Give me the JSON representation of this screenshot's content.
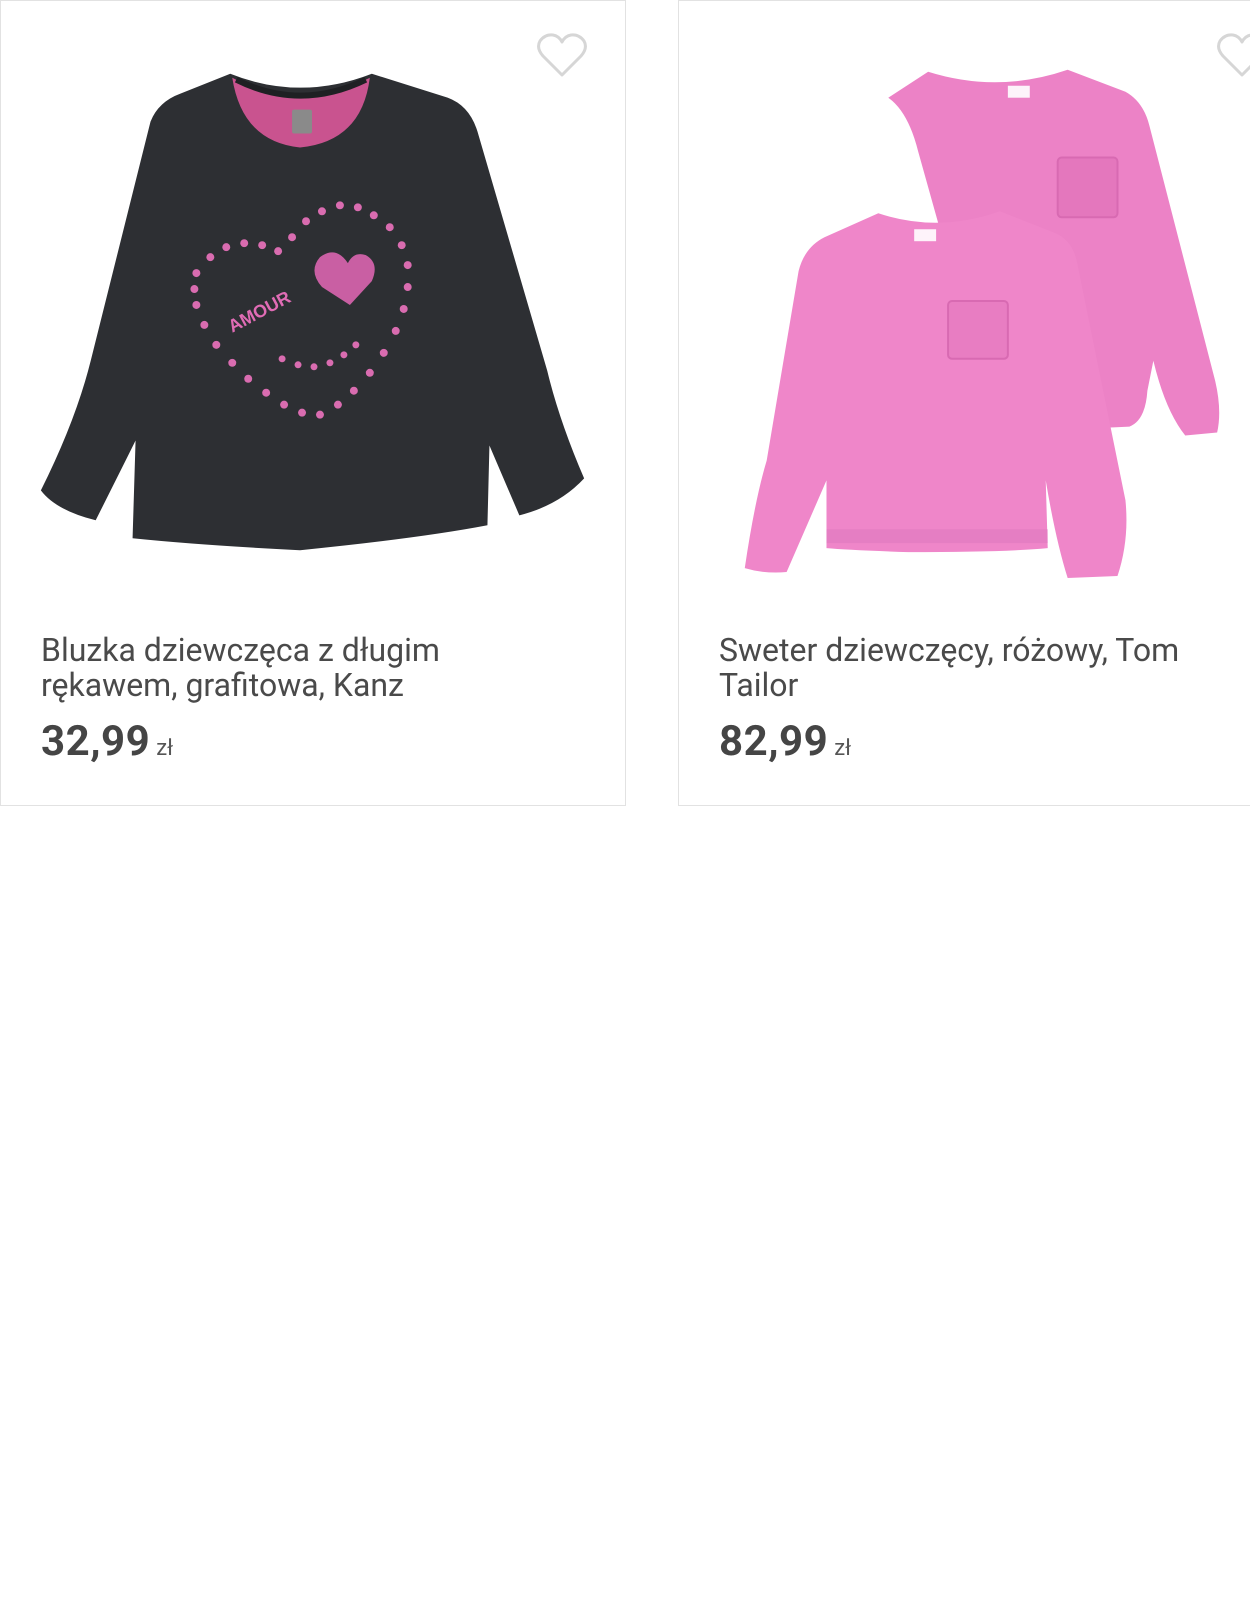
{
  "products": [
    {
      "title": "Bluzka dziewczęca z długim rękawem, grafitowa, Kanz",
      "price": "32,99",
      "currency": "zł",
      "image_text": "AMOUR",
      "favorite_icon": "heart-outline-icon",
      "colors": {
        "garment": "#2d2f33",
        "accent": "#e06cb5"
      }
    },
    {
      "title": "Sweter dziewczęcy, różowy, Tom Tailor",
      "price": "82,99",
      "currency": "zł",
      "favorite_icon": "heart-outline-icon",
      "colors": {
        "garment": "#ec82c6",
        "accent": "#d86ab2"
      }
    }
  ]
}
